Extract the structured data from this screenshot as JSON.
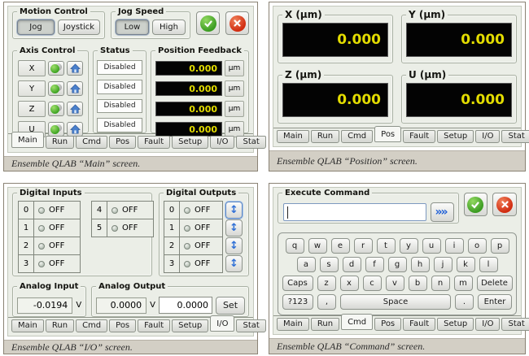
{
  "tabs": [
    "Main",
    "Run",
    "Cmd",
    "Pos",
    "Fault",
    "Setup",
    "I/O",
    "Stat"
  ],
  "colors": {
    "panel_bg": "#ebeee7",
    "caption_bg": "#d3cfc5",
    "figure_border": "#8a8274",
    "display_bg": "#030303",
    "display_text": "#e3dc00",
    "led_green": "#37a01e",
    "arrow_blue": "#2f6fd6",
    "confirm_green": "#3c9c22",
    "cancel_red": "#d12c10",
    "home_blue": "#4a80cc"
  },
  "icons": {
    "confirm": "check-circle-icon",
    "cancel": "x-circle-icon",
    "home": "home-icon",
    "led_toggle": "led-toggle-icon",
    "output_toggle": "up-down-arrow-icon",
    "send": "double-chevron-right-icon",
    "led_off": "led-dot-icon"
  },
  "figures": {
    "main": {
      "caption": "Ensemble QLAB “Main” screen.",
      "active_tab": "Main",
      "groups": {
        "motion_control": "Motion Control",
        "jog_speed": "Jog Speed",
        "axis_control": "Axis Control",
        "status": "Status",
        "position_feedback": "Position Feedback"
      },
      "motion_buttons": {
        "jog": "Jog",
        "joystick": "Joystick"
      },
      "speed_buttons": {
        "low": "Low",
        "high": "High"
      },
      "axes": [
        "X",
        "Y",
        "Z",
        "U"
      ],
      "status_value": "Disabled",
      "position_value": "0.000",
      "unit": "µm"
    },
    "position": {
      "caption": "Ensemble QLAB “Position” screen.",
      "active_tab": "Pos",
      "groups": [
        {
          "label": "X (µm)",
          "value": "0.000"
        },
        {
          "label": "Y (µm)",
          "value": "0.000"
        },
        {
          "label": "Z (µm)",
          "value": "0.000"
        },
        {
          "label": "U (µm)",
          "value": "0.000"
        }
      ]
    },
    "io": {
      "caption": "Ensemble QLAB “I/O” screen.",
      "active_tab": "I/O",
      "digital_inputs": {
        "label": "Digital Inputs",
        "left": [
          {
            "n": "0",
            "state": "OFF"
          },
          {
            "n": "1",
            "state": "OFF"
          },
          {
            "n": "2",
            "state": "OFF"
          },
          {
            "n": "3",
            "state": "OFF"
          }
        ],
        "right": [
          {
            "n": "4",
            "state": "OFF"
          },
          {
            "n": "5",
            "state": "OFF"
          }
        ]
      },
      "digital_outputs": {
        "label": "Digital Outputs",
        "channels": [
          {
            "n": "0",
            "state": "OFF"
          },
          {
            "n": "1",
            "state": "OFF"
          },
          {
            "n": "2",
            "state": "OFF"
          },
          {
            "n": "3",
            "state": "OFF"
          }
        ]
      },
      "analog_input": {
        "label": "Analog Input",
        "value": "-0.0194",
        "unit": "V"
      },
      "analog_output": {
        "label": "Analog Output",
        "value": "0.0000",
        "unit": "V",
        "input_value": "0.0000",
        "set_label": "Set"
      }
    },
    "command": {
      "caption": "Ensemble QLAB “Command” screen.",
      "active_tab": "Cmd",
      "execute": {
        "label": "Execute Command",
        "input_value": ""
      },
      "keyboard": {
        "rows": [
          [
            "q",
            "w",
            "e",
            "r",
            "t",
            "y",
            "u",
            "i",
            "o",
            "p"
          ],
          [
            "a",
            "s",
            "d",
            "f",
            "g",
            "h",
            "j",
            "k",
            "l"
          ],
          [
            "Caps",
            "z",
            "x",
            "c",
            "v",
            "b",
            "n",
            "m",
            "Delete"
          ],
          [
            "?123",
            ",",
            "Space",
            ".",
            "Enter"
          ]
        ]
      }
    }
  }
}
